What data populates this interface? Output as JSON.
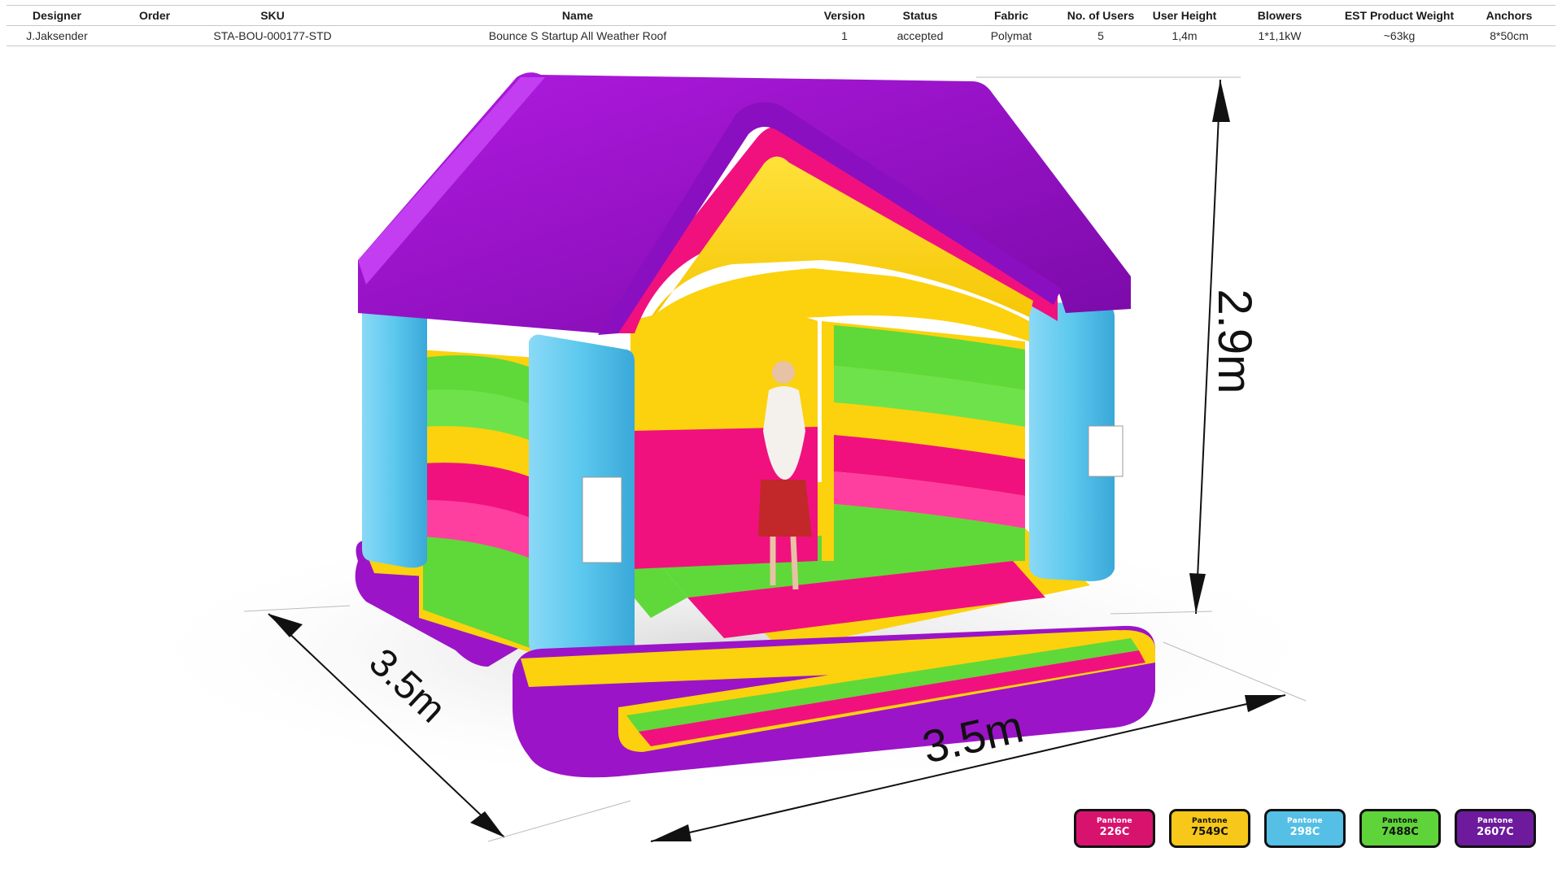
{
  "spec_table": {
    "headers": [
      "Designer",
      "Order",
      "SKU",
      "Name",
      "Version",
      "Status",
      "Fabric",
      "No. of Users",
      "User  Height",
      "Blowers",
      "EST Product Weight",
      "Anchors"
    ],
    "values": [
      "J.Jaksender",
      "",
      "STA-BOU-000177-STD",
      "Bounce S Startup All Weather Roof",
      "1",
      "accepted",
      "Polymat",
      "5",
      "1,4m",
      "1*1,1kW",
      "~63kg",
      "8*50cm"
    ]
  },
  "dimensions": {
    "height": "2.9m",
    "depth": "3.5m",
    "width": "3.5m"
  },
  "colors": {
    "pink": "#f0117f",
    "yellow": "#fbd20d",
    "blue": "#5cc8ee",
    "green": "#5fd83a",
    "purple": "#8a0fc0"
  },
  "swatches": [
    {
      "brand": "Pantone",
      "code": "226C",
      "color": "#d7136e"
    },
    {
      "brand": "Pantone",
      "code": "7549C",
      "color": "#f7c81a"
    },
    {
      "brand": "Pantone",
      "code": "298C",
      "color": "#55bfe6"
    },
    {
      "brand": "Pantone",
      "code": "7488C",
      "color": "#5fd43a"
    },
    {
      "brand": "Pantone",
      "code": "2607C",
      "color": "#6d1a9c"
    }
  ]
}
